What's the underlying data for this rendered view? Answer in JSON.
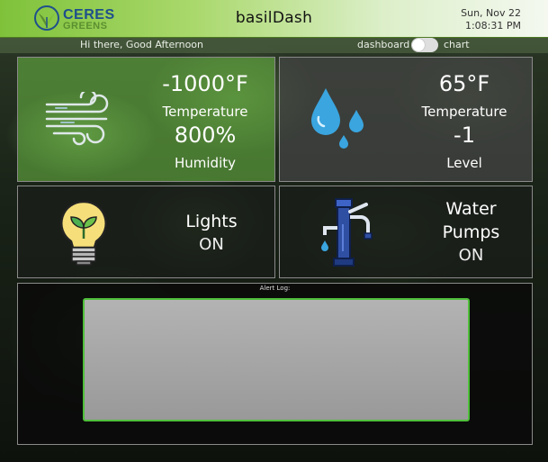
{
  "header": {
    "logo_line1": "CERES",
    "logo_line2": "GREENS",
    "app_title": "basilDash",
    "date": "Sun, Nov 22",
    "time": "1:08:31 PM"
  },
  "subbar": {
    "greeting": "Hi there, Good Afternoon",
    "toggle_left_label": "dashboard",
    "toggle_right_label": "chart"
  },
  "cards": {
    "air": {
      "temperature_value": "-1000°F",
      "temperature_label": "Temperature",
      "humidity_value": "800%",
      "humidity_label": "Humidity",
      "icon": "wind-icon"
    },
    "water": {
      "temperature_value": "65°F",
      "temperature_label": "Temperature",
      "level_value": "-1",
      "level_label": "Level",
      "icon": "water-drops-icon"
    },
    "lights": {
      "label": "Lights",
      "status": "ON",
      "icon": "lightbulb-icon"
    },
    "pumps": {
      "label_line1": "Water",
      "label_line2": "Pumps",
      "status": "ON",
      "icon": "water-pump-icon"
    }
  },
  "alert_log": {
    "title": "Alert Log:",
    "content": ""
  },
  "colors": {
    "header_green": "#7fc23a",
    "accent_blue": "#1e4f8c",
    "alert_border": "#4fbf3a"
  }
}
